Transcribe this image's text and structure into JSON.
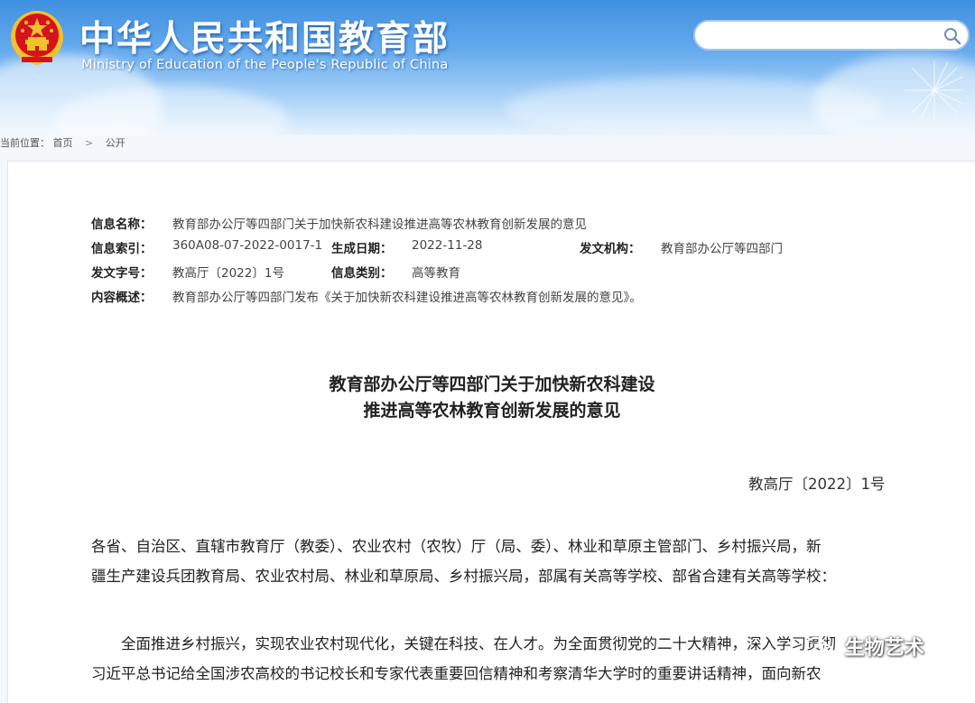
{
  "header": {
    "title_cn": "中华人民共和国教育部",
    "title_en": "Ministry of Education of the People's Republic of China",
    "search": {
      "value": "",
      "placeholder": ""
    }
  },
  "breadcrumb": {
    "label": "当前位置：",
    "items": [
      "首页",
      "公开"
    ],
    "separator": ">"
  },
  "info": {
    "name_label": "信息名称：",
    "name_value": "教育部办公厅等四部门关于加快新农科建设推进高等农林教育创新发展的意见",
    "index_label": "信息索引：",
    "index_value": "360A08-07-2022-0017-1",
    "date_label": "生成日期：",
    "date_value": "2022-11-28",
    "agency_label": "发文机构：",
    "agency_value": "教育部办公厅等四部门",
    "docno_label": "发文字号：",
    "docno_value": "教高厅〔2022〕1号",
    "category_label": "信息类别：",
    "category_value": "高等教育",
    "summary_label": "内容概述：",
    "summary_value": "教育部办公厅等四部门发布《关于加快新农科建设推进高等农林教育创新发展的意见》。"
  },
  "document": {
    "title_line1": "教育部办公厅等四部门关于加快新农科建设",
    "title_line2": "推进高等农林教育创新发展的意见",
    "number": "教高厅〔2022〕1号",
    "recipients_line1": "各省、自治区、直辖市教育厅（教委）、农业农村（农牧）厅（局、委）、林业和草原主管部门、乡村振兴局，新",
    "recipients_line2": "疆生产建设兵团教育局、农业农村局、林业和草原局、乡村振兴局，部属有关高等学校、部省合建有关高等学校：",
    "body_line1": "　　全面推进乡村振兴，实现农业农村现代化，关键在科技、在人才。为全面贯彻党的二十大精神，深入学习贯彻",
    "body_line2": "习近平总书记给全国涉农高校的书记校长和专家代表重要回信精神和考察清华大学时的重要讲话精神，面向新农"
  },
  "watermark": {
    "text": "生物艺术"
  },
  "colors": {
    "header_top": "#3f8fe0",
    "header_bottom": "#e6f2fd",
    "emblem_red": "#d4141a",
    "emblem_gold": "#f2c12e"
  }
}
